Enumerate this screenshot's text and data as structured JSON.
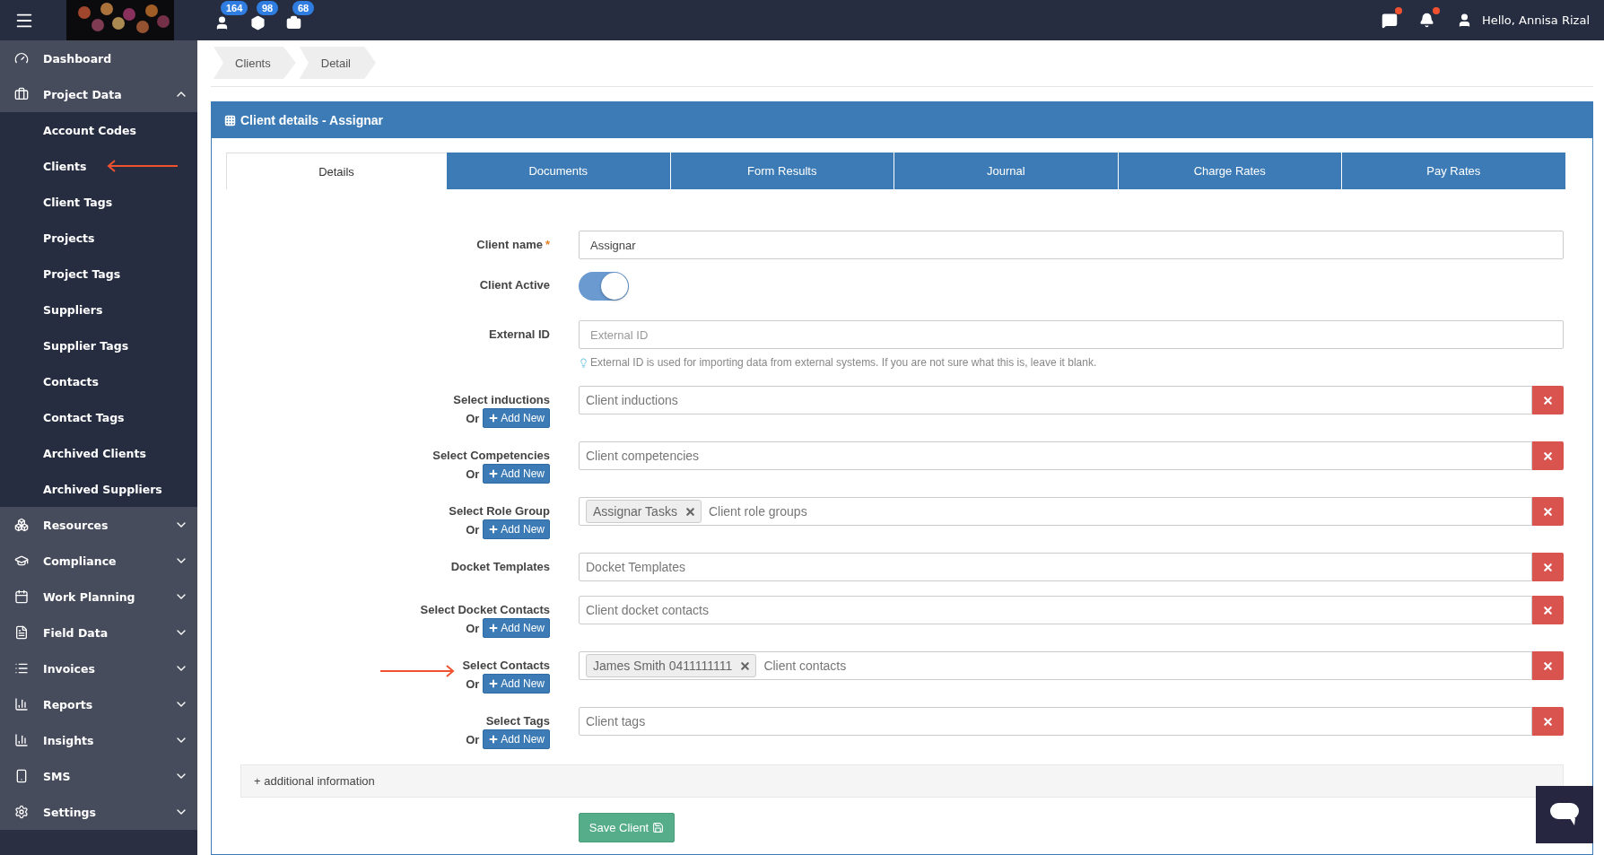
{
  "topbar": {
    "badges": [
      {
        "count": "164"
      },
      {
        "count": "98"
      },
      {
        "count": "68"
      }
    ],
    "messages_unread": true,
    "notifications_unread": true,
    "user": "Hello, Annisa Rizal"
  },
  "sidebar": {
    "items": [
      {
        "label": "Dashboard",
        "kind": "link"
      },
      {
        "label": "Project Data",
        "kind": "group",
        "expanded": true,
        "children": [
          {
            "label": "Account Codes",
            "arrow": false
          },
          {
            "label": "Clients",
            "arrow": true
          },
          {
            "label": "Client Tags",
            "arrow": false
          },
          {
            "label": "Projects",
            "arrow": false
          },
          {
            "label": "Project Tags",
            "arrow": false
          },
          {
            "label": "Suppliers",
            "arrow": false
          },
          {
            "label": "Supplier Tags",
            "arrow": false
          },
          {
            "label": "Contacts",
            "arrow": false
          },
          {
            "label": "Contact Tags",
            "arrow": false
          },
          {
            "label": "Archived Clients",
            "arrow": false
          },
          {
            "label": "Archived Suppliers",
            "arrow": false
          }
        ]
      },
      {
        "label": "Resources",
        "kind": "group",
        "expanded": false
      },
      {
        "label": "Compliance",
        "kind": "group",
        "expanded": false
      },
      {
        "label": "Work Planning",
        "kind": "group",
        "expanded": false
      },
      {
        "label": "Field Data",
        "kind": "group",
        "expanded": false
      },
      {
        "label": "Invoices",
        "kind": "group",
        "expanded": false
      },
      {
        "label": "Reports",
        "kind": "group",
        "expanded": false
      },
      {
        "label": "Insights",
        "kind": "group",
        "expanded": false
      },
      {
        "label": "SMS",
        "kind": "group",
        "expanded": false
      },
      {
        "label": "Settings",
        "kind": "group",
        "expanded": false
      }
    ]
  },
  "breadcrumbs": [
    "Clients",
    "Detail"
  ],
  "panel": {
    "title": "Client details - Assignar",
    "tabs": [
      {
        "label": "Details",
        "selected": true
      },
      {
        "label": "Documents",
        "selected": false
      },
      {
        "label": "Form Results",
        "selected": false
      },
      {
        "label": "Journal",
        "selected": false
      },
      {
        "label": "Charge Rates",
        "selected": false
      },
      {
        "label": "Pay Rates",
        "selected": false
      }
    ],
    "fields": [
      {
        "kind": "text",
        "label": "Client name",
        "required_mark": "*",
        "value": "Assignar"
      },
      {
        "kind": "toggle",
        "label": "Client Active",
        "on": true
      },
      {
        "kind": "text",
        "label": "External ID",
        "placeholder": "External ID",
        "help": "External ID is used for importing data from external systems. If you are not sure what this is, leave it blank."
      },
      {
        "kind": "select",
        "label": "Select inductions",
        "or": "Or",
        "add_new": "Add New",
        "placeholder": "Client inductions",
        "arrow": false
      },
      {
        "kind": "select",
        "label": "Select Competencies",
        "or": "Or",
        "add_new": "Add New",
        "placeholder": "Client competencies",
        "arrow": false
      },
      {
        "kind": "select",
        "label": "Select Role Group",
        "or": "Or",
        "add_new": "Add New",
        "tags": [
          "Assignar Tasks"
        ],
        "placeholder": "Client role groups",
        "arrow": false
      },
      {
        "kind": "select",
        "label": "Docket Templates",
        "placeholder": "Docket Templates",
        "arrow": false
      },
      {
        "kind": "select",
        "label": "Select Docket Contacts",
        "or": "Or",
        "add_new": "Add New",
        "placeholder": "Client docket contacts",
        "arrow": false
      },
      {
        "kind": "select",
        "label": "Select Contacts",
        "or": "Or",
        "add_new": "Add New",
        "tags": [
          "James Smith 0411111111"
        ],
        "placeholder": "Client contacts",
        "arrow": true
      },
      {
        "kind": "select",
        "label": "Select Tags",
        "or": "Or",
        "add_new": "Add New",
        "placeholder": "Client tags",
        "arrow": false
      }
    ],
    "additional": "+ additional information",
    "save": "Save Client"
  }
}
